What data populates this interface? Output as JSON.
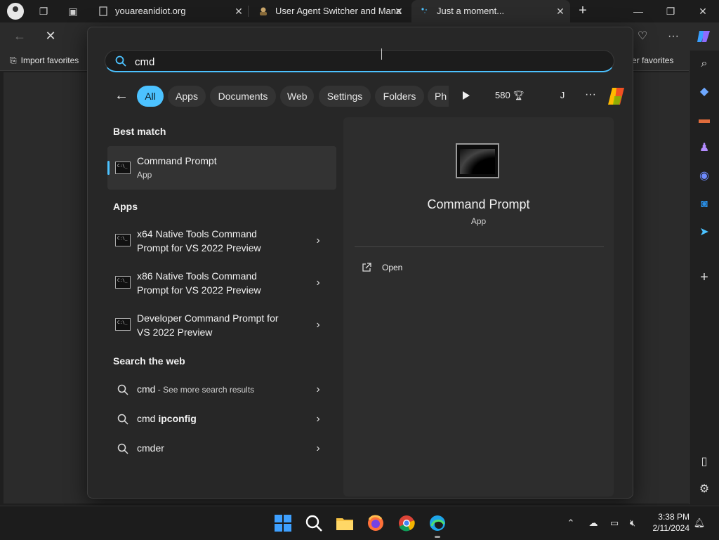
{
  "browser": {
    "tabs": [
      {
        "title": "youareanidiot.org"
      },
      {
        "title": "User Agent Switcher and Mana"
      },
      {
        "title": "Just a moment..."
      }
    ],
    "favorites_bar": {
      "import": "Import favorites",
      "other": "ther favorites"
    }
  },
  "search": {
    "query": "cmd",
    "filters": [
      "All",
      "Apps",
      "Documents",
      "Web",
      "Settings",
      "Folders",
      "Ph"
    ],
    "active_filter": "All",
    "points": "580",
    "avatar": "J"
  },
  "results": {
    "best_match_heading": "Best match",
    "best_match": {
      "title": "Command Prompt",
      "subtitle": "App"
    },
    "apps_heading": "Apps",
    "apps": [
      {
        "line1": "x64 Native Tools Command",
        "line2": "Prompt for VS 2022 Preview"
      },
      {
        "line1": "x86 Native Tools Command",
        "line2": "Prompt for VS 2022 Preview"
      },
      {
        "line1": "Developer Command Prompt for",
        "line2": "VS 2022 Preview"
      }
    ],
    "web_heading": "Search the web",
    "web": [
      {
        "main": "cmd",
        "extra": " - See more search results"
      },
      {
        "main": "cmd ",
        "bold": "ipconfig"
      },
      {
        "main": "cmder"
      }
    ]
  },
  "preview": {
    "title": "Command Prompt",
    "subtitle": "App",
    "actions": [
      "Open"
    ]
  },
  "taskbar": {
    "time": "3:38 PM",
    "date": "2/11/2024"
  },
  "colors": {
    "accent": "#4cc2ff",
    "flyout_bg": "#272727"
  }
}
